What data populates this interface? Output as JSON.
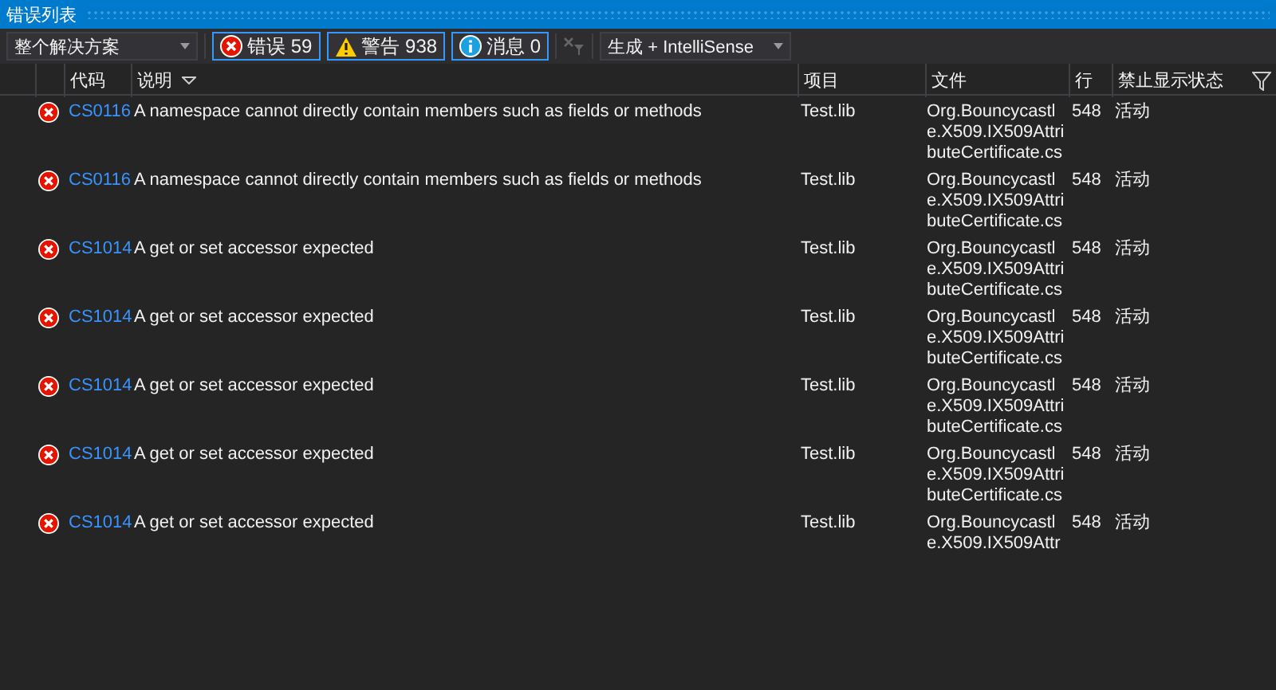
{
  "window": {
    "title": "错误列表"
  },
  "toolbar": {
    "scope": "整个解决方案",
    "filters": [
      {
        "kind": "error",
        "label": "错误 59",
        "selected": true
      },
      {
        "kind": "warning",
        "label": "警告 938",
        "selected": true
      },
      {
        "kind": "info",
        "label": "消息 0",
        "selected": true
      }
    ],
    "source": "生成 + IntelliSense"
  },
  "table": {
    "columns": [
      "代码",
      "说明",
      "项目",
      "文件",
      "行",
      "禁止显示状态"
    ],
    "rows": [
      {
        "kind": "error",
        "code": "CS0116",
        "description": "A namespace cannot directly contain members such as fields or methods",
        "project": "Test.lib",
        "file": "Org.Bouncycastle.X509.IX509AttributeCertificate.cs",
        "line": "548",
        "state": "活动"
      },
      {
        "kind": "error",
        "code": "CS0116",
        "description": "A namespace cannot directly contain members such as fields or methods",
        "project": "Test.lib",
        "file": "Org.Bouncycastle.X509.IX509AttributeCertificate.cs",
        "line": "548",
        "state": "活动"
      },
      {
        "kind": "error",
        "code": "CS1014",
        "description": "A get or set accessor expected",
        "project": "Test.lib",
        "file": "Org.Bouncycastle.X509.IX509AttributeCertificate.cs",
        "line": "548",
        "state": "活动"
      },
      {
        "kind": "error",
        "code": "CS1014",
        "description": "A get or set accessor expected",
        "project": "Test.lib",
        "file": "Org.Bouncycastle.X509.IX509AttributeCertificate.cs",
        "line": "548",
        "state": "活动"
      },
      {
        "kind": "error",
        "code": "CS1014",
        "description": "A get or set accessor expected",
        "project": "Test.lib",
        "file": "Org.Bouncycastle.X509.IX509AttributeCertificate.cs",
        "line": "548",
        "state": "活动"
      },
      {
        "kind": "error",
        "code": "CS1014",
        "description": "A get or set accessor expected",
        "project": "Test.lib",
        "file": "Org.Bouncycastle.X509.IX509AttributeCertificate.cs",
        "line": "548",
        "state": "活动"
      },
      {
        "kind": "error",
        "code": "CS1014",
        "description": "A get or set accessor expected",
        "project": "Test.lib",
        "file": "Org.Bouncycastle.X509.IX509Attr",
        "line": "548",
        "state": "活动"
      }
    ]
  }
}
